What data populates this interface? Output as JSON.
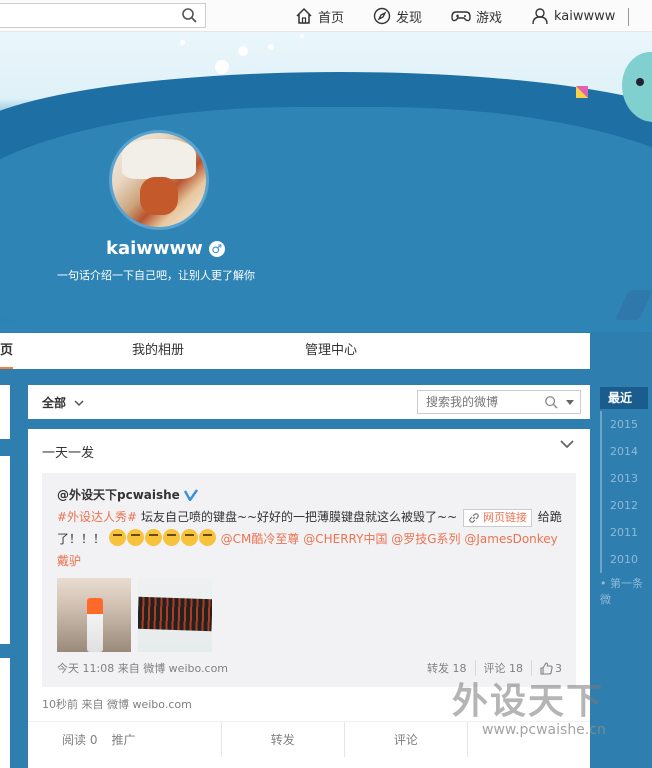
{
  "topbar": {
    "search_placeholder": "",
    "nav": [
      {
        "label": "首页",
        "icon": "home-icon"
      },
      {
        "label": "发现",
        "icon": "compass-icon"
      },
      {
        "label": "游戏",
        "icon": "gamepad-icon"
      },
      {
        "label": "kaiwwww",
        "icon": "user-icon"
      }
    ]
  },
  "profile": {
    "username": "kaiwwww",
    "gender_symbol": "♂",
    "intro": "一句话介绍一下自己吧，让别人更了解你"
  },
  "tabs": [
    {
      "label": "页",
      "active": true
    },
    {
      "label": "我的相册",
      "active": false
    },
    {
      "label": "管理中心",
      "active": false
    }
  ],
  "filter": {
    "all_label": "全部",
    "search_placeholder": "搜索我的微博"
  },
  "post": {
    "title": "一天一发",
    "repost": {
      "author": "@外设天下pcwaishe",
      "topic": "#外设达人秀#",
      "text1": " 坛友自己喷的键盘~~好好的一把薄膜键盘就这么被毁了~~ ",
      "link_label": "网页链接",
      "text2": " 给跪",
      "text3": "了！！！",
      "mentions": "@CM酷冷至尊 @CHERRY中国 @罗技G系列 @JamesDonkey戴驴",
      "meta": "今天 11:08 来自 微博 weibo.com",
      "forward": "转发 18",
      "comment": "评论 18",
      "like": "3"
    },
    "meta": "10秒前 来自 微博 weibo.com",
    "actions": {
      "read": "阅读 0",
      "promote": "推广",
      "forward": "转发",
      "comment": "评论"
    }
  },
  "timeline": {
    "recent": "最近",
    "years": [
      "2015",
      "2014",
      "2013",
      "2012",
      "2011",
      "2010"
    ],
    "first": "第一条微"
  },
  "watermark": {
    "big": "外设天下",
    "small": "www.pcwaishe.cn"
  },
  "colors": {
    "accent": "#fa7d3c",
    "link": "#eb7350",
    "bg": "#2e7fb0"
  }
}
